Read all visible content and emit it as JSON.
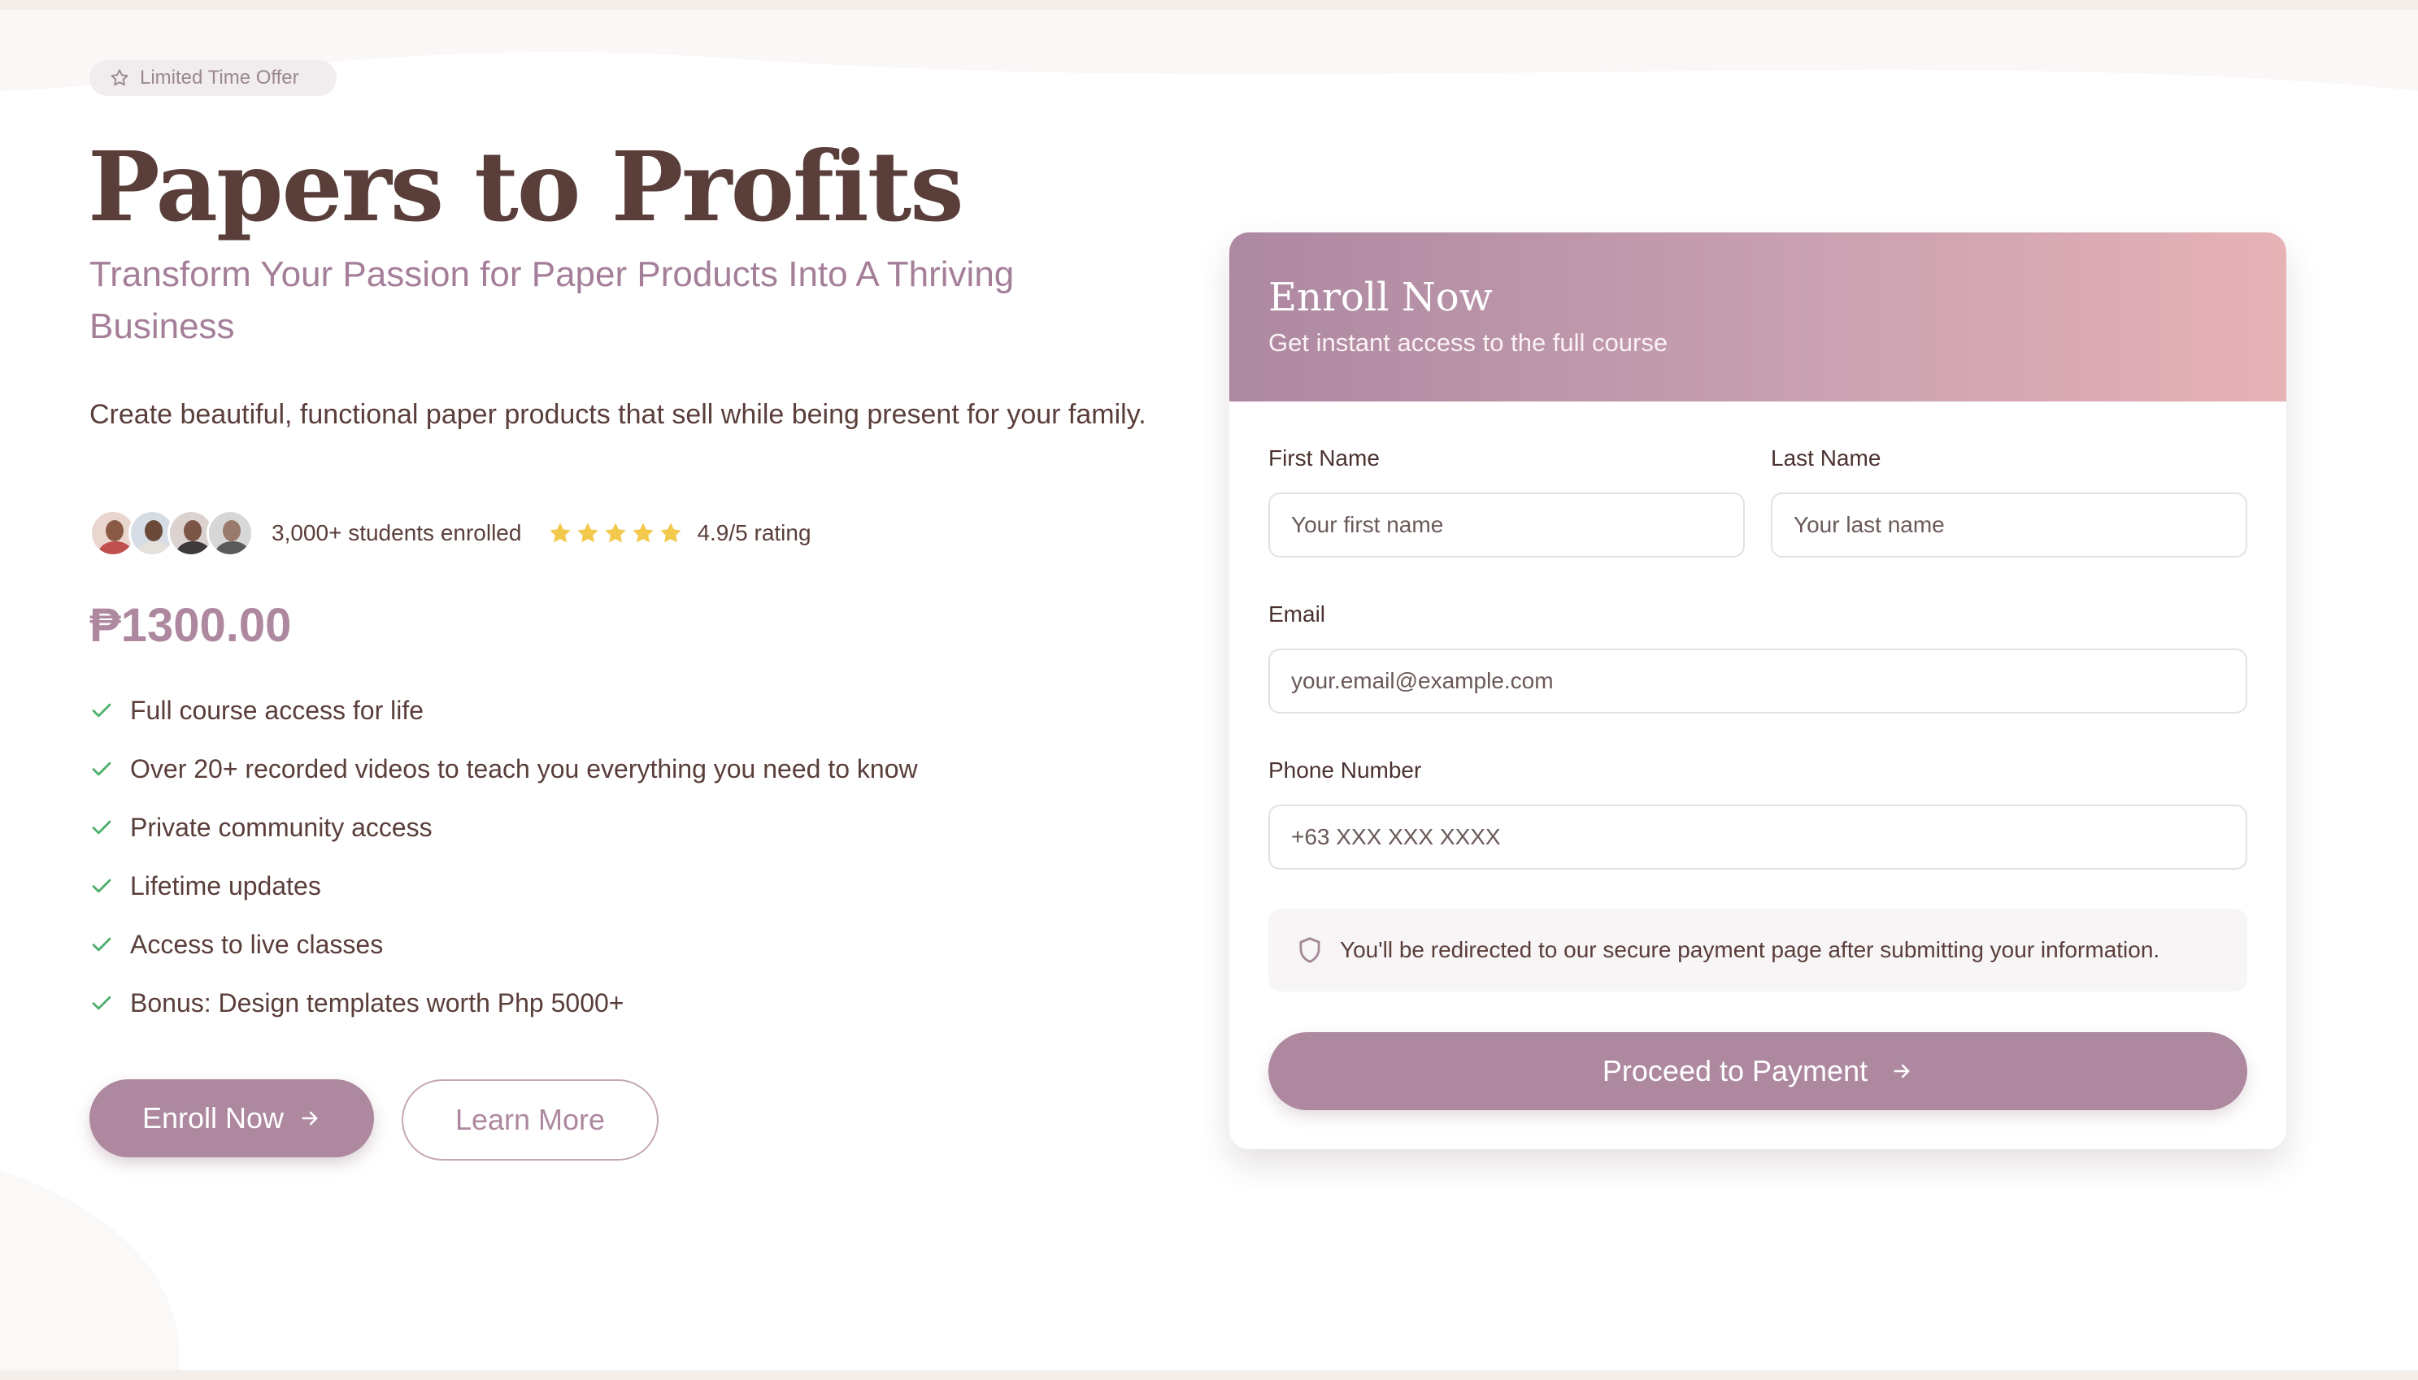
{
  "badge": {
    "text": "Limited Time Offer",
    "icon": "star-outline-icon"
  },
  "hero": {
    "title": "Papers to Profits",
    "subtitle": "Transform Your Passion for Paper Products Into A Thriving Business",
    "description": "Create beautiful, functional paper products that sell while being present for your family."
  },
  "social_proof": {
    "students": "3,000+ students enrolled",
    "rating_text": "4.9/5 rating",
    "stars": 5,
    "avatars": [
      "avatar-1",
      "avatar-2",
      "avatar-3",
      "avatar-4"
    ]
  },
  "price": "₱1300.00",
  "features": [
    "Full course access for life",
    "Over 20+ recorded videos to teach you everything you need to know",
    "Private community access",
    "Lifetime updates",
    "Access to live classes",
    "Bonus: Design templates worth Php 5000+"
  ],
  "buttons": {
    "enroll": "Enroll Now",
    "learn_more": "Learn More"
  },
  "form": {
    "title": "Enroll Now",
    "subtitle": "Get instant access to the full course",
    "first_name": {
      "label": "First Name",
      "placeholder": "Your first name",
      "value": ""
    },
    "last_name": {
      "label": "Last Name",
      "placeholder": "Your last name",
      "value": ""
    },
    "email": {
      "label": "Email",
      "placeholder": "your.email@example.com",
      "value": ""
    },
    "phone": {
      "label": "Phone Number",
      "placeholder": "+63 XXX XXX XXXX",
      "value": ""
    },
    "notice": "You'll be redirected to our secure payment page after submitting your information.",
    "submit": "Proceed to Payment"
  },
  "colors": {
    "accent": "#ad889f",
    "heading": "#5a3e3a",
    "subtitle": "#a57f99",
    "check": "#4caf6a",
    "star": "#f2c94c",
    "gradient_start": "#ad88a1",
    "gradient_end": "#e7b2b6"
  }
}
